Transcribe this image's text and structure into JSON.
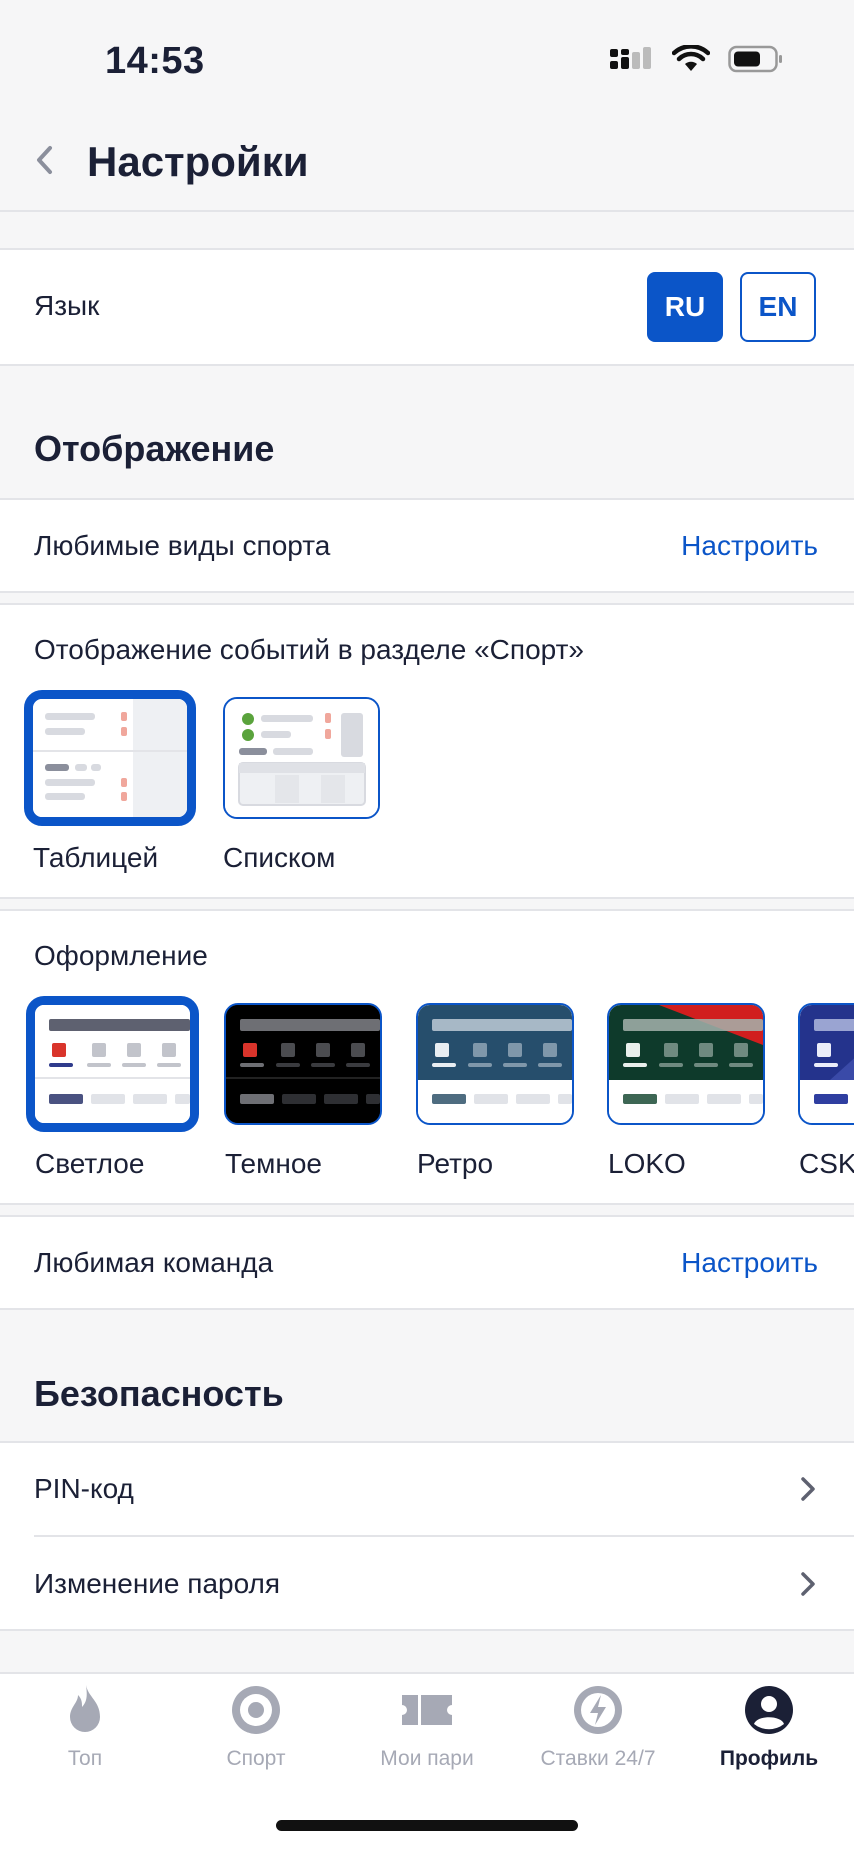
{
  "status_bar": {
    "time": "14:53"
  },
  "header": {
    "title": "Настройки"
  },
  "language": {
    "label": "Язык",
    "options": [
      {
        "code": "RU",
        "selected": true
      },
      {
        "code": "EN",
        "selected": false
      }
    ]
  },
  "display": {
    "section_title": "Отображение",
    "favorite_sports": {
      "label": "Любимые виды спорта",
      "action": "Настроить"
    },
    "events_view": {
      "label": "Отображение событий в разделе «Спорт»",
      "options": [
        {
          "label": "Таблицей",
          "selected": true
        },
        {
          "label": "Списком",
          "selected": false
        }
      ]
    },
    "theme": {
      "label": "Оформление",
      "options": [
        {
          "label": "Светлое",
          "selected": true
        },
        {
          "label": "Темное",
          "selected": false
        },
        {
          "label": "Ретро",
          "selected": false
        },
        {
          "label": "LOKO",
          "selected": false
        },
        {
          "label": "CSK",
          "selected": false
        }
      ]
    },
    "favorite_team": {
      "label": "Любимая команда",
      "action": "Настроить"
    }
  },
  "security": {
    "section_title": "Безопасность",
    "items": [
      {
        "label": "PIN-код"
      },
      {
        "label": "Изменение пароля"
      }
    ]
  },
  "tabbar": {
    "items": [
      {
        "label": "Топ",
        "icon": "flame-icon",
        "active": false
      },
      {
        "label": "Спорт",
        "icon": "sport-target-icon",
        "active": false
      },
      {
        "label": "Мои пари",
        "icon": "ticket-icon",
        "active": false
      },
      {
        "label": "Ставки 24/7",
        "icon": "lightning-icon",
        "active": false
      },
      {
        "label": "Профиль",
        "icon": "profile-icon",
        "active": true
      }
    ]
  },
  "colors": {
    "accent": "#0b55c8",
    "text": "#1b2036",
    "background": "#f6f6f7",
    "inactive_tab": "#a6a9b5"
  }
}
